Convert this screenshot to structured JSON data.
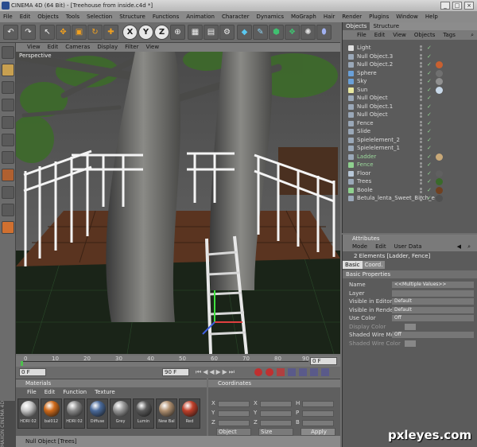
{
  "window": {
    "title": "CINEMA 4D (64 Bit) - [Treehouse from inside.c4d *]"
  },
  "menubar": [
    "File",
    "Edit",
    "Objects",
    "Tools",
    "Selection",
    "Structure",
    "Functions",
    "Animation",
    "Character",
    "Dynamics",
    "MoGraph",
    "Hair",
    "Render",
    "Plugins",
    "Window",
    "Help"
  ],
  "toolbar": {
    "x_label": "X",
    "y_label": "Y",
    "z_label": "Z"
  },
  "viewport": {
    "menu": [
      "View",
      "Edit",
      "Cameras",
      "Display",
      "Filter",
      "View"
    ],
    "label": "Perspective"
  },
  "timeline": {
    "ticks": [
      "0",
      "10",
      "20",
      "30",
      "40",
      "50",
      "60",
      "70",
      "80",
      "90"
    ],
    "frame_end": "0 F"
  },
  "anim": {
    "start": "0 F",
    "end": "90 F"
  },
  "materials": {
    "title": "Materials",
    "menu": [
      "File",
      "Edit",
      "Function",
      "Texture"
    ],
    "items": [
      "HDRI 02",
      "bal012",
      "HDRI 02",
      "Diffuse",
      "Grey",
      "Lumin",
      "New Bal",
      "Red"
    ],
    "colors": [
      "#c8c8c8",
      "#d06a1a",
      "#8a8a8a",
      "#4a6a9a",
      "#9a9a9a",
      "#5a5a5a",
      "#b09070",
      "#c0402a"
    ]
  },
  "coords": {
    "title": "Coordinates",
    "rows": [
      [
        "X",
        "X",
        "H"
      ],
      [
        "Y",
        "Y",
        "P"
      ],
      [
        "Z",
        "Z",
        "B"
      ]
    ],
    "object": "Object",
    "size": "Size",
    "apply": "Apply"
  },
  "status": "Null Object [Trees]",
  "maxon": "MAXON CINEMA 4D",
  "objmgr": {
    "tabs": [
      "Objects",
      "Structure"
    ],
    "menu": [
      "File",
      "Edit",
      "View",
      "Objects",
      "Tags"
    ],
    "rows": [
      {
        "name": "Light",
        "icon": "#e0e0e0",
        "tag": ""
      },
      {
        "name": "Null Object.3",
        "icon": "#9aa8b8",
        "tag": ""
      },
      {
        "name": "Null Object.2",
        "icon": "#9aa8b8",
        "tag": "#c86030"
      },
      {
        "name": "Sphere",
        "icon": "#6aa0d8",
        "tag": "#707070"
      },
      {
        "name": "Sky",
        "icon": "#6aa0d8",
        "tag": "#909090"
      },
      {
        "name": "Sun",
        "icon": "#e8e8a0",
        "tag": "#c8d8e8"
      },
      {
        "name": "Null Object",
        "icon": "#9aa8b8",
        "tag": ""
      },
      {
        "name": "Null Object.1",
        "icon": "#9aa8b8",
        "tag": ""
      },
      {
        "name": "Null Object",
        "icon": "#9aa8b8",
        "tag": ""
      },
      {
        "name": "Fence",
        "icon": "#9aa8b8",
        "tag": ""
      },
      {
        "name": "Slide",
        "icon": "#9aa8b8",
        "tag": ""
      },
      {
        "name": "Spielelement_2",
        "icon": "#9aa8b8",
        "tag": ""
      },
      {
        "name": "Spielelement_1",
        "icon": "#9aa8b8",
        "tag": ""
      },
      {
        "name": "Ladder",
        "icon": "#9aa8b8",
        "tag": "#c8a878"
      },
      {
        "name": "Fence",
        "icon": "#8fd18f",
        "tag": ""
      },
      {
        "name": "Floor",
        "icon": "#b8c8d8",
        "tag": "#606060"
      },
      {
        "name": "Trees",
        "icon": "#9aa8b8",
        "tag": "#3a6a2a"
      },
      {
        "name": "Boole",
        "icon": "#8fd18f",
        "tag": "#704020"
      },
      {
        "name": "Betula_lenta_Sweet_Birch_e",
        "icon": "#9aa8b8",
        "tag": "#505050"
      }
    ],
    "highlighted": [
      13,
      14
    ]
  },
  "attributes": {
    "title": "Attributes",
    "menu": [
      "Mode",
      "Edit",
      "User Data"
    ],
    "header": "2 Elements [Ladder, Fence]",
    "tabs": [
      "Basic",
      "Coord."
    ],
    "section": "Basic Properties",
    "fields": [
      {
        "label": "Name",
        "value": "<<Multiple Values>>"
      },
      {
        "label": "Layer",
        "value": ""
      },
      {
        "label": "Visible in Editor",
        "value": "Default"
      },
      {
        "label": "Visible in Renderer",
        "value": "Default"
      },
      {
        "label": "Use Color",
        "value": "Off"
      },
      {
        "label": "Display Color",
        "value": ""
      },
      {
        "label": "Shaded Wire Mode",
        "value": "Off"
      },
      {
        "label": "Shaded Wire Color",
        "value": ""
      }
    ]
  },
  "watermark": "pxleyes.com"
}
